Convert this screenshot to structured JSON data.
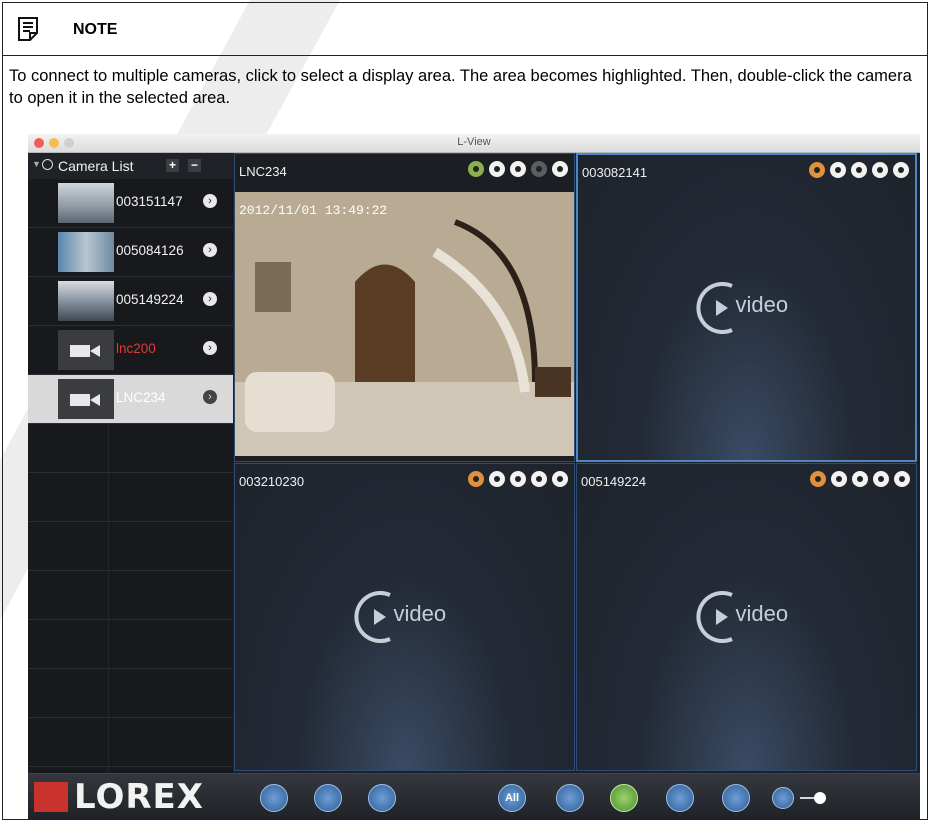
{
  "note": {
    "title": "NOTE",
    "text": "To connect to multiple cameras, click to select a display area. The area becomes highlighted. Then, double-click the camera to open it in the selected area."
  },
  "app": {
    "window_title": "L-View",
    "camera_list_label": "Camera List",
    "add_label": "+",
    "remove_label": "−",
    "cameras": [
      {
        "name": "003151147",
        "color": "#f2f2f2"
      },
      {
        "name": "005084126",
        "color": "#f2f2f2"
      },
      {
        "name": "005149224",
        "color": "#f2f2f2"
      },
      {
        "name": "lnc200",
        "color": "#e23b32"
      },
      {
        "name": "LNC234",
        "color": "#ffffff"
      }
    ],
    "panes": [
      {
        "title": "LNC234",
        "timestamp": "2012/11/01 13:49:22"
      },
      {
        "title": "003082141",
        "video_label": "video"
      },
      {
        "title": "003210230",
        "video_label": "video"
      },
      {
        "title": "005149224",
        "video_label": "video"
      }
    ],
    "bottom": {
      "brand": "LOREX",
      "all_label": "All"
    }
  },
  "colors": {
    "accent_blue": "#4c86c6",
    "brand_red": "#c9322d",
    "offline_camera": "#e23b32"
  }
}
